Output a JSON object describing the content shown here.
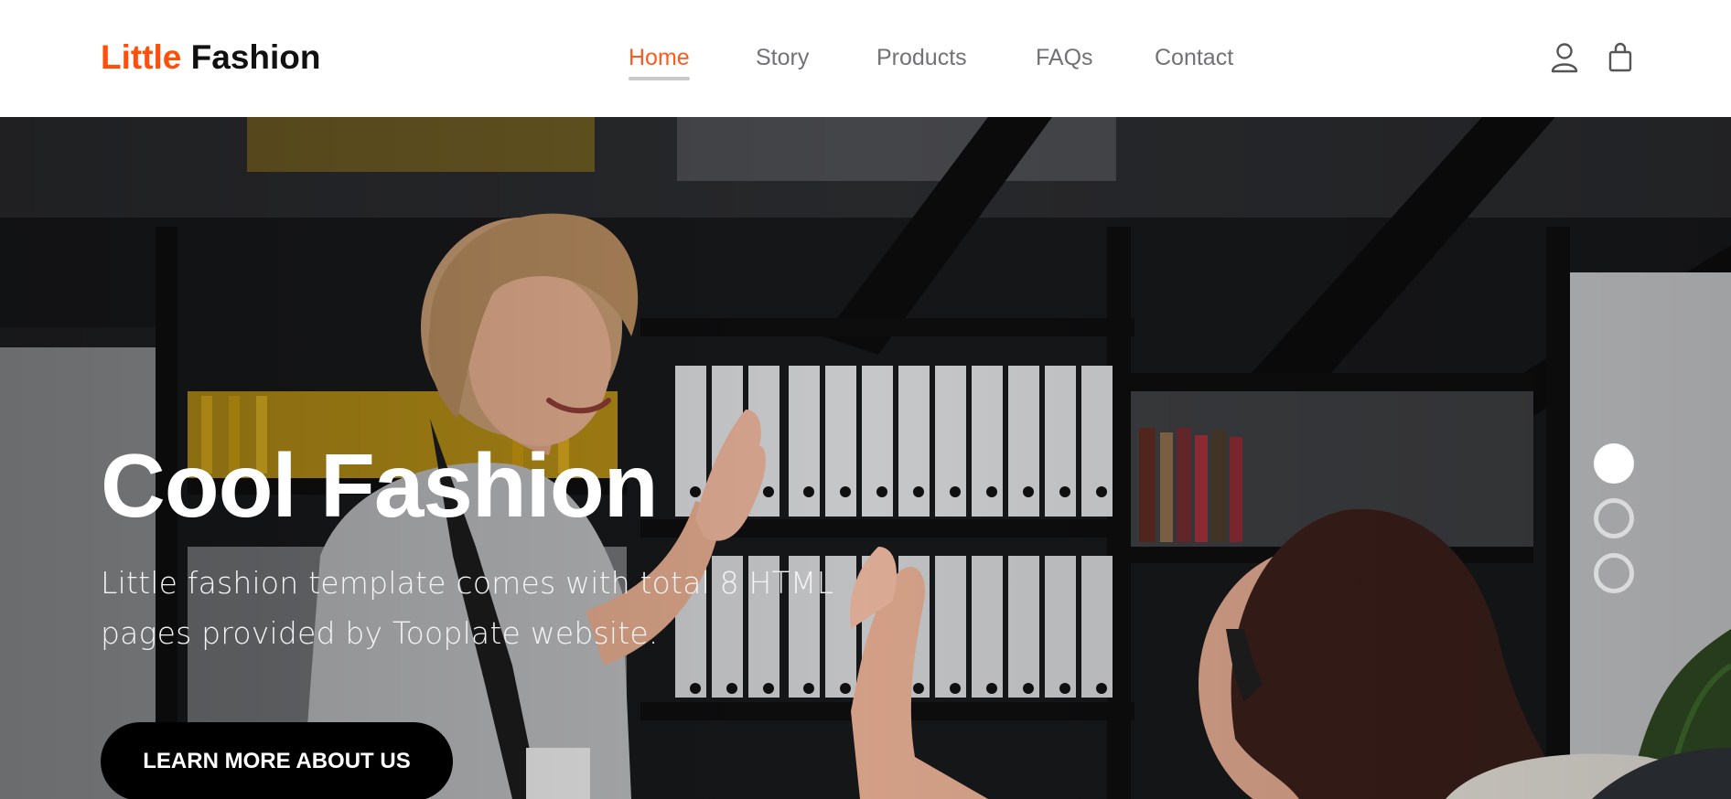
{
  "brand": {
    "part1": "Little",
    "part2": "Fashion"
  },
  "nav": {
    "items": [
      {
        "label": "Home",
        "active": true
      },
      {
        "label": "Story",
        "active": false
      },
      {
        "label": "Products",
        "active": false
      },
      {
        "label": "FAQs",
        "active": false
      },
      {
        "label": "Contact",
        "active": false
      }
    ],
    "icons": [
      "user-icon",
      "shopping-bag-icon"
    ]
  },
  "hero": {
    "title": "Cool Fashion",
    "subtitle_line1": "Little fashion template comes with total 8 HTML",
    "subtitle_line2": "pages provided by Tooplate website.",
    "cta_label": "LEARN MORE ABOUT US",
    "carousel": {
      "slides": 3,
      "active_index": 0
    }
  },
  "colors": {
    "accent": "#ff4f0a",
    "nav_text": "#717275",
    "cta_bg": "#000000",
    "hero_text": "#ffffff"
  }
}
